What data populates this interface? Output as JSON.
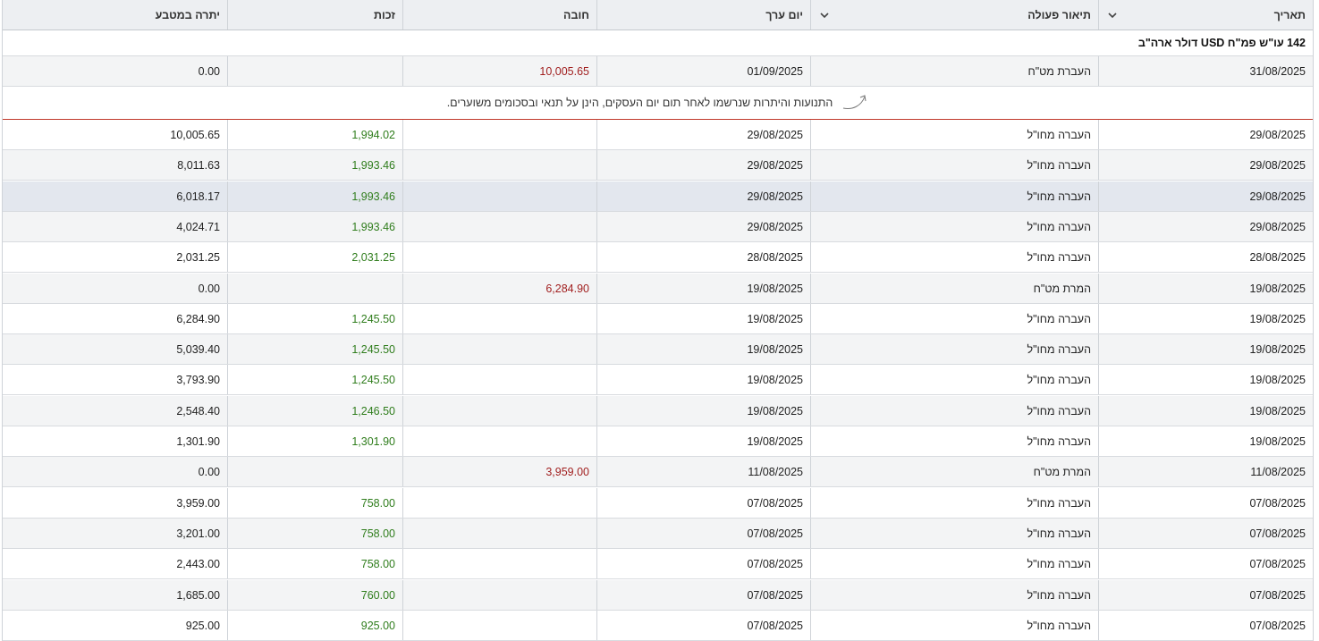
{
  "columns": {
    "date": "תאריך",
    "description": "תיאור פעולה",
    "value_date": "יום ערך",
    "debit": "חובה",
    "credit": "זכות",
    "balance": "יתרה במטבע"
  },
  "group_title": "142 עו\"ש פמ\"ח USD דולר ארה\"ב",
  "notice": "התנועות והיתרות שנרשמו לאחר תום יום העסקים, הינן על תנאי ובסכומים משוערים.",
  "pending_rows": [
    {
      "date": "31/08/2025",
      "description": "העברת מט\"ח",
      "value_date": "01/09/2025",
      "debit": "10,005.65",
      "credit": "",
      "balance": "0.00"
    }
  ],
  "rows": [
    {
      "date": "29/08/2025",
      "description": "העברה מחו\"ל",
      "value_date": "29/08/2025",
      "debit": "",
      "credit": "1,994.02",
      "balance": "10,005.65"
    },
    {
      "date": "29/08/2025",
      "description": "העברה מחו\"ל",
      "value_date": "29/08/2025",
      "debit": "",
      "credit": "1,993.46",
      "balance": "8,011.63"
    },
    {
      "date": "29/08/2025",
      "description": "העברה מחו\"ל",
      "value_date": "29/08/2025",
      "debit": "",
      "credit": "1,993.46",
      "balance": "6,018.17"
    },
    {
      "date": "29/08/2025",
      "description": "העברה מחו\"ל",
      "value_date": "29/08/2025",
      "debit": "",
      "credit": "1,993.46",
      "balance": "4,024.71"
    },
    {
      "date": "28/08/2025",
      "description": "העברה מחו\"ל",
      "value_date": "28/08/2025",
      "debit": "",
      "credit": "2,031.25",
      "balance": "2,031.25"
    },
    {
      "date": "19/08/2025",
      "description": "המרת מט\"ח",
      "value_date": "19/08/2025",
      "debit": "6,284.90",
      "credit": "",
      "balance": "0.00"
    },
    {
      "date": "19/08/2025",
      "description": "העברה מחו\"ל",
      "value_date": "19/08/2025",
      "debit": "",
      "credit": "1,245.50",
      "balance": "6,284.90"
    },
    {
      "date": "19/08/2025",
      "description": "העברה מחו\"ל",
      "value_date": "19/08/2025",
      "debit": "",
      "credit": "1,245.50",
      "balance": "5,039.40"
    },
    {
      "date": "19/08/2025",
      "description": "העברה מחו\"ל",
      "value_date": "19/08/2025",
      "debit": "",
      "credit": "1,245.50",
      "balance": "3,793.90"
    },
    {
      "date": "19/08/2025",
      "description": "העברה מחו\"ל",
      "value_date": "19/08/2025",
      "debit": "",
      "credit": "1,246.50",
      "balance": "2,548.40"
    },
    {
      "date": "19/08/2025",
      "description": "העברה מחו\"ל",
      "value_date": "19/08/2025",
      "debit": "",
      "credit": "1,301.90",
      "balance": "1,301.90"
    },
    {
      "date": "11/08/2025",
      "description": "המרת מט\"ח",
      "value_date": "11/08/2025",
      "debit": "3,959.00",
      "credit": "",
      "balance": "0.00"
    },
    {
      "date": "07/08/2025",
      "description": "העברה מחו\"ל",
      "value_date": "07/08/2025",
      "debit": "",
      "credit": "758.00",
      "balance": "3,959.00"
    },
    {
      "date": "07/08/2025",
      "description": "העברה מחו\"ל",
      "value_date": "07/08/2025",
      "debit": "",
      "credit": "758.00",
      "balance": "3,201.00"
    },
    {
      "date": "07/08/2025",
      "description": "העברה מחו\"ל",
      "value_date": "07/08/2025",
      "debit": "",
      "credit": "758.00",
      "balance": "2,443.00"
    },
    {
      "date": "07/08/2025",
      "description": "העברה מחו\"ל",
      "value_date": "07/08/2025",
      "debit": "",
      "credit": "760.00",
      "balance": "1,685.00"
    },
    {
      "date": "07/08/2025",
      "description": "העברה מחו\"ל",
      "value_date": "07/08/2025",
      "debit": "",
      "credit": "925.00",
      "balance": "925.00"
    }
  ],
  "colors": {
    "debit": "#a11f1f",
    "credit": "#2f7d1c",
    "header_bg": "#edeff2",
    "zebra_bg": "#f3f4f5",
    "highlight_bg": "#e3e7ee",
    "notice_line": "#c0392b"
  },
  "icons": {
    "sort": "chevron-down-icon",
    "notice": "curved-arrow-icon"
  }
}
